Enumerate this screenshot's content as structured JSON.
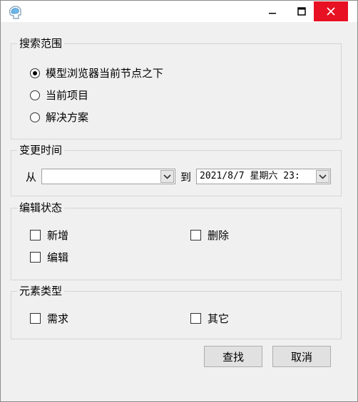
{
  "window": {
    "title": "",
    "icons": {
      "app": "brain-app-icon",
      "minimize": "minimize-icon",
      "maximize": "maximize-icon",
      "close": "close-icon"
    }
  },
  "search_scope": {
    "title": "搜索范围",
    "options": [
      "模型浏览器当前节点之下",
      "当前项目",
      "解决方案"
    ],
    "selected": 0
  },
  "change_time": {
    "title": "变更时间",
    "from_label": "从",
    "from_value": "",
    "to_label": "到",
    "to_value": "2021/8/7 星期六 23:"
  },
  "edit_state": {
    "title": "编辑状态",
    "options": [
      {
        "label": "新增",
        "checked": false
      },
      {
        "label": "删除",
        "checked": false
      },
      {
        "label": "编辑",
        "checked": false
      }
    ]
  },
  "element_type": {
    "title": "元素类型",
    "options": [
      {
        "label": "需求",
        "checked": false
      },
      {
        "label": "其它",
        "checked": false
      }
    ]
  },
  "buttons": {
    "find": "查找",
    "cancel": "取消"
  },
  "colors": {
    "close_button": "#e81123",
    "dialog_bg": "#f0f0f0",
    "button_bg": "#e1e1e1"
  }
}
